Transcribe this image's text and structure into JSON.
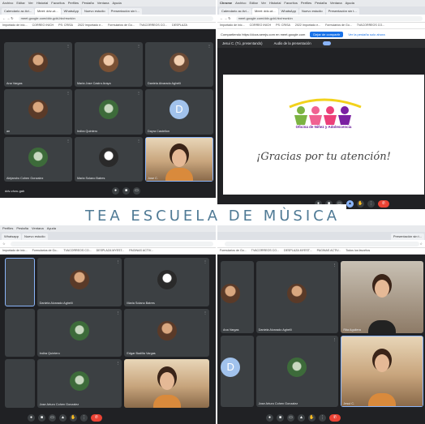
{
  "banner": {
    "text": "TEA ESCUELA DE MÙSICA"
  },
  "top_left": {
    "menu": [
      "Archivo",
      "Editar",
      "Ver",
      "Historial",
      "Favoritos",
      "Perfiles",
      "Pestaña",
      "Ventana",
      "Ayuda"
    ],
    "tabs": [
      "Calendario ac.tivi...",
      "Meet: ddv-ut...",
      "WhatsApp",
      "Nuevo estudio",
      "Presentación sin t..."
    ],
    "url": "meet.google.com/ddv-gdd-hix/reunión",
    "bookmarks": [
      "Importado de inic...",
      "CORREO INICH",
      "PS: CRISA",
      "2022 Importado e...",
      "Formularios de Go...",
      "TVACORREOS CO...",
      "DESPLAZA"
    ],
    "tiles": [
      {
        "name": "Ana Vargas"
      },
      {
        "name": "Maria Jose Castro Araya"
      },
      {
        "name": "Daniela Alvarado Aghelli"
      },
      {
        "name": "an"
      },
      {
        "name": "Indira Quintero"
      },
      {
        "name": "Dayra Castellon"
      },
      {
        "name": "Alejandro Cohen Gonzalez"
      },
      {
        "name": "Maria Solano Batres"
      },
      {
        "name": "Jose C."
      }
    ],
    "letter_avatar": "D",
    "footer": "ddv-chzu-gah"
  },
  "top_right": {
    "menu": [
      "Chrome",
      "Archivo",
      "Editar",
      "Ver",
      "Historial",
      "Favoritos",
      "Perfiles",
      "Pestaña",
      "Ventana",
      "Ayuda"
    ],
    "tabs": [
      "Calendario ac.tivi...",
      "Meet: ddv-ut...",
      "WhatsApp",
      "Nuevo estudio",
      "Presentación sin t..."
    ],
    "url": "meet.google.com/ddv-gdd-hix/reunión",
    "bookmarks": [
      "Importado de inic...",
      "CORREO INICH",
      "PS: CRISA",
      "2022 Importado e...",
      "Formularios de Go...",
      "TVACORREOS CO...",
      "DESPLAZA"
    ],
    "infobar": {
      "text": "Compartiendo https://docs.semjs.com en meet.google.com",
      "button": "Dejar de compartir",
      "link": "Ver la pestaña solo ahora"
    },
    "presbar": {
      "presenter": "Jesui C. (Tú, presentando)",
      "audio": "Audio de la presentación"
    },
    "slide": {
      "org": "Oficina de Niñez y Adolescencia",
      "thanks": "¡Gracias por tu atención!"
    }
  },
  "bottom_left": {
    "menu": [
      "Perfiles",
      "Pestaña",
      "Ventana",
      "Ayuda"
    ],
    "tabs": [
      "Whatsapp",
      "Nuevo estudio"
    ],
    "bookmarks": [
      "Importado de inic...",
      "Formularios de Go...",
      "TVACORREOS CO...",
      "DESPLAZA MYEST...",
      "PAGINAS ACTIV..."
    ],
    "tiles": [
      {
        "name": "Daniela Alvarado Aghelli"
      },
      {
        "name": "Maria Solano Batres"
      },
      {
        "name": "Indira Quintero"
      },
      {
        "name": "Edgar Badilla Vargas"
      },
      {
        "name": "Jose Arturo Cohen Gonzalez"
      },
      {
        "name": ""
      }
    ]
  },
  "bottom_right": {
    "tabs": [
      "Presentación sin t..."
    ],
    "bookmarks": [
      "Formularios de Go...",
      "TVACORREOS CO...",
      "DESPLAZA MYEST...",
      "PAGINAS ACTIV...",
      "Todos los favoritos"
    ],
    "tiles": [
      {
        "name": "Ana Vargas"
      },
      {
        "name": "Daniela Alvarado Aghelli"
      },
      {
        "name": "Rita Aguilera"
      },
      {
        "name": ""
      },
      {
        "name": "Jose Arturo Cohen Gonzalez"
      },
      {
        "name": "Jesui C."
      }
    ],
    "letter_avatar": "D"
  }
}
